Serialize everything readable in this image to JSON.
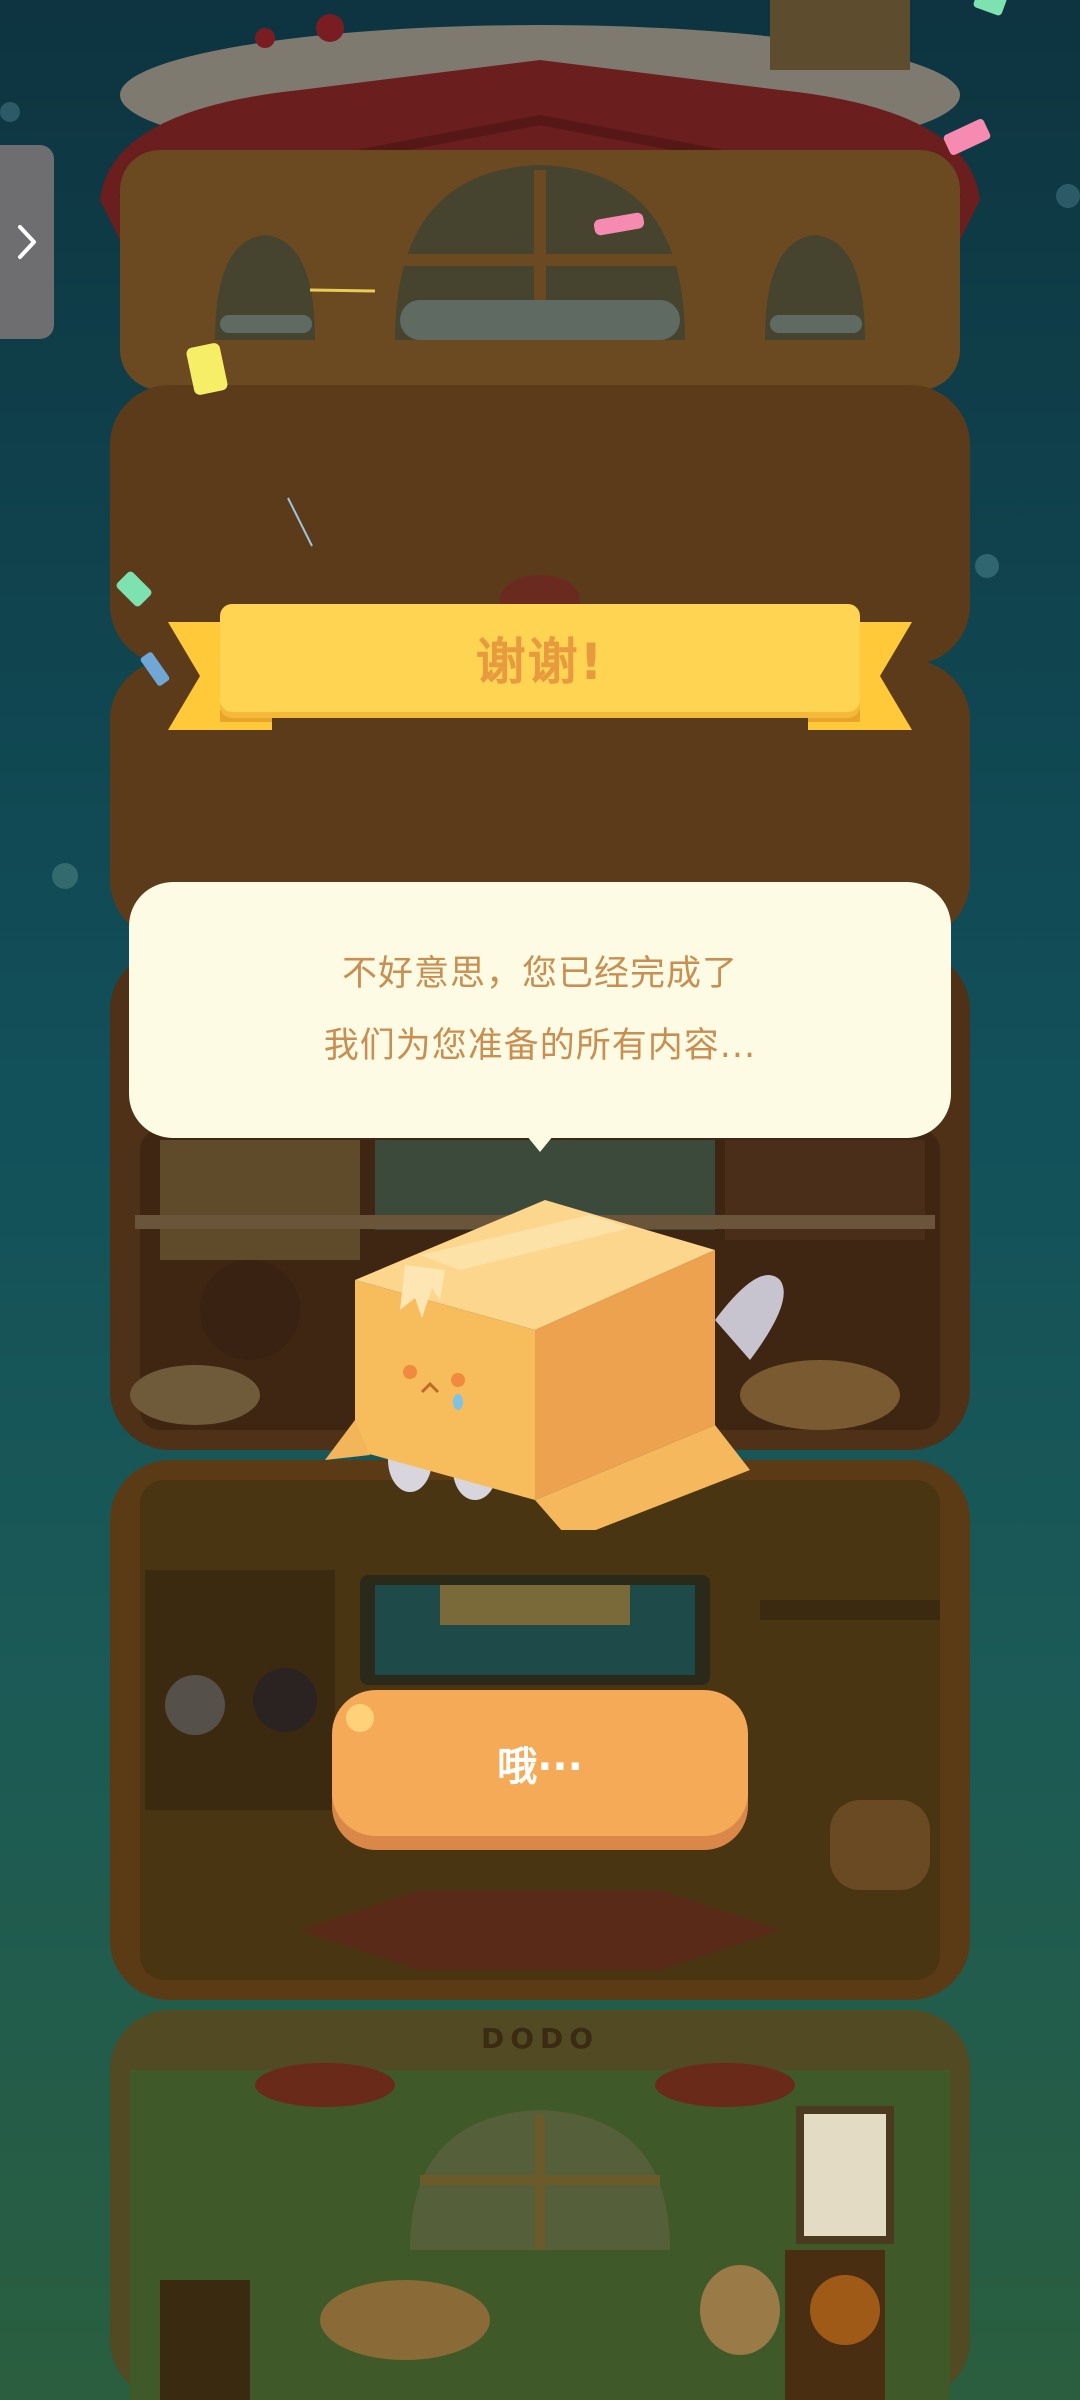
{
  "banner": {
    "title": "谢谢!"
  },
  "message": {
    "line1": "不好意思，您已经完成了",
    "line2": "我们为您准备的所有内容..."
  },
  "confirm_button": {
    "label": "哦···"
  },
  "side_panel": {
    "icon": "chevron-right-icon"
  },
  "signage": {
    "tower_sign": "DODO"
  },
  "colors": {
    "background_top": "#0d3440",
    "ribbon": "#ffd452",
    "ribbon_text": "#e79a3e",
    "bubble": "#fdfbe4",
    "bubble_text": "#c98e51",
    "button": "#f5aa58",
    "button_shadow": "#d98849"
  }
}
